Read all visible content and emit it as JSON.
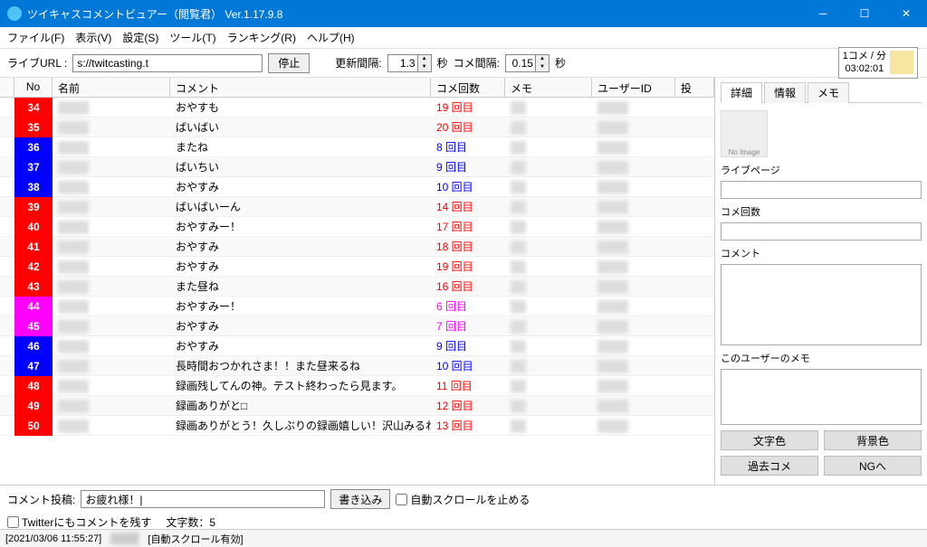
{
  "title": "ツイキャスコメントビュアー（閲覧君） Ver.1.17.9.8",
  "menu": [
    "ファイル(F)",
    "表示(V)",
    "設定(S)",
    "ツール(T)",
    "ランキング(R)",
    "ヘルプ(H)"
  ],
  "toolbar": {
    "url_label": "ライブURL :",
    "url_value": "s://twitcasting.t",
    "stop": "停止",
    "update_label": "更新間隔:",
    "update_value": "1.3",
    "sec1": "秒",
    "comment_label": "コメ間隔:",
    "comment_value": "0.15",
    "sec2": "秒"
  },
  "rate": {
    "line1": "1コメ / 分",
    "line2": "03:02:01"
  },
  "headers": {
    "no": "No",
    "name": "名前",
    "comment": "コメント",
    "count": "コメ回数",
    "memo": "メモ",
    "uid": "ユーザーID",
    "last": "投"
  },
  "rows": [
    {
      "no": "34",
      "bg": "red",
      "comment": "おやすも",
      "count": "19 回目",
      "tx": "red"
    },
    {
      "no": "35",
      "bg": "red",
      "comment": "ばいばい",
      "count": "20 回目",
      "tx": "red"
    },
    {
      "no": "36",
      "bg": "blue",
      "comment": "またね",
      "count": "8 回目",
      "tx": "blue"
    },
    {
      "no": "37",
      "bg": "blue",
      "comment": "ばいちい",
      "count": "9 回目",
      "tx": "blue"
    },
    {
      "no": "38",
      "bg": "blue",
      "comment": "おやすみ",
      "count": "10 回目",
      "tx": "blue"
    },
    {
      "no": "39",
      "bg": "red",
      "comment": "ばいばいーん",
      "count": "14 回目",
      "tx": "red"
    },
    {
      "no": "40",
      "bg": "red",
      "comment": "おやすみー！",
      "count": "17 回目",
      "tx": "red"
    },
    {
      "no": "41",
      "bg": "red",
      "comment": "おやすみ",
      "count": "18 回目",
      "tx": "red"
    },
    {
      "no": "42",
      "bg": "red",
      "comment": "おやすみ",
      "count": "19 回目",
      "tx": "red"
    },
    {
      "no": "43",
      "bg": "red",
      "comment": "また昼ね",
      "count": "16 回目",
      "tx": "red"
    },
    {
      "no": "44",
      "bg": "magenta",
      "comment": "おやすみー！",
      "count": "6 回目",
      "tx": "magenta"
    },
    {
      "no": "45",
      "bg": "magenta",
      "comment": "おやすみ",
      "count": "7 回目",
      "tx": "magenta"
    },
    {
      "no": "46",
      "bg": "blue",
      "comment": "おやすみ",
      "count": "9 回目",
      "tx": "blue"
    },
    {
      "no": "47",
      "bg": "blue",
      "comment": "長時間おつかれさま！！また昼来るね",
      "count": "10 回目",
      "tx": "blue"
    },
    {
      "no": "48",
      "bg": "red",
      "comment": "録画残してんの神。テスト終わったら見ます。",
      "count": "11 回目",
      "tx": "red"
    },
    {
      "no": "49",
      "bg": "red",
      "comment": "録画ありがと□",
      "count": "12 回目",
      "tx": "red"
    },
    {
      "no": "50",
      "bg": "red",
      "comment": "録画ありがとう！久しぶりの録画嬉しい！沢山みるねー😊",
      "count": "13 回目",
      "tx": "red"
    }
  ],
  "side": {
    "tabs": [
      "詳細",
      "情報",
      "メモ"
    ],
    "avatar": "No Image",
    "livepage": "ライブページ",
    "count": "コメ回数",
    "comment": "コメント",
    "memo": "このユーザーのメモ",
    "btns": [
      "文字色",
      "背景色",
      "過去コメ",
      "NGへ"
    ]
  },
  "bottom": {
    "label": "コメント投稿:",
    "value": "お疲れ様！|",
    "submit": "書き込み",
    "stopscroll": "自動スクロールを止める",
    "twitter": "Twitterにもコメントを残す",
    "charcount_label": "文字数：",
    "charcount": "5"
  },
  "status": {
    "time": "[2021/03/06 11:55:27]",
    "scroll": "[自動スクロール有効]"
  }
}
